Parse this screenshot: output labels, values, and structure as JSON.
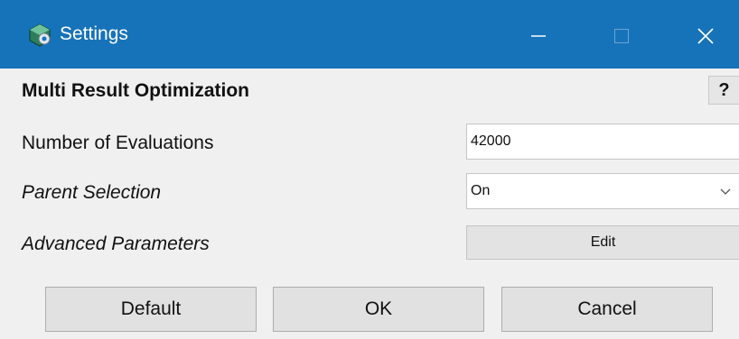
{
  "window": {
    "title": "Settings",
    "app_icon": "settings-app-icon",
    "controls": {
      "minimize_icon": "minimize-icon",
      "maximize_icon": "maximize-icon",
      "close_icon": "close-icon"
    },
    "titlebar_color": "#1773b9"
  },
  "section": {
    "title": "Multi Result Optimization",
    "help_label": "?"
  },
  "fields": {
    "evaluations": {
      "label": "Number of Evaluations",
      "value": "42000"
    },
    "parent_selection": {
      "label": "Parent Selection",
      "value": "On"
    },
    "advanced_parameters": {
      "label": "Advanced Parameters",
      "button_label": "Edit"
    }
  },
  "buttons": {
    "default_label": "Default",
    "ok_label": "OK",
    "cancel_label": "Cancel"
  }
}
